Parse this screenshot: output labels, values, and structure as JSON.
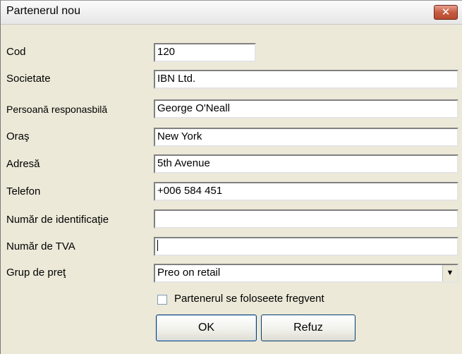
{
  "window": {
    "title": "Partenerul nou",
    "close_symbol": "✕",
    "close_icon": "close-icon"
  },
  "form": {
    "fields": [
      {
        "label": "Cod",
        "value": "120"
      },
      {
        "label": "Societate",
        "value": "IBN Ltd."
      },
      {
        "label": "Persoană responasbilă",
        "value": "George O'Neall"
      },
      {
        "label": "Oraş",
        "value": "New York"
      },
      {
        "label": "Adresă",
        "value": "5th Avenue"
      },
      {
        "label": "Telefon",
        "value": "+006 584 451"
      },
      {
        "label": "Număr de identificaţie",
        "value": ""
      },
      {
        "label": "Număr de TVA",
        "value": ""
      }
    ],
    "price_group": {
      "label": "Grup de preţ",
      "selected": "Preo on retail",
      "arrow_symbol": "▼",
      "arrow_icon": "chevron-down-icon"
    },
    "frequent_checkbox": {
      "label": "Partenerul se foloseete fregvent",
      "checked": false
    }
  },
  "buttons": {
    "ok": "OK",
    "cancel": "Refuz"
  }
}
